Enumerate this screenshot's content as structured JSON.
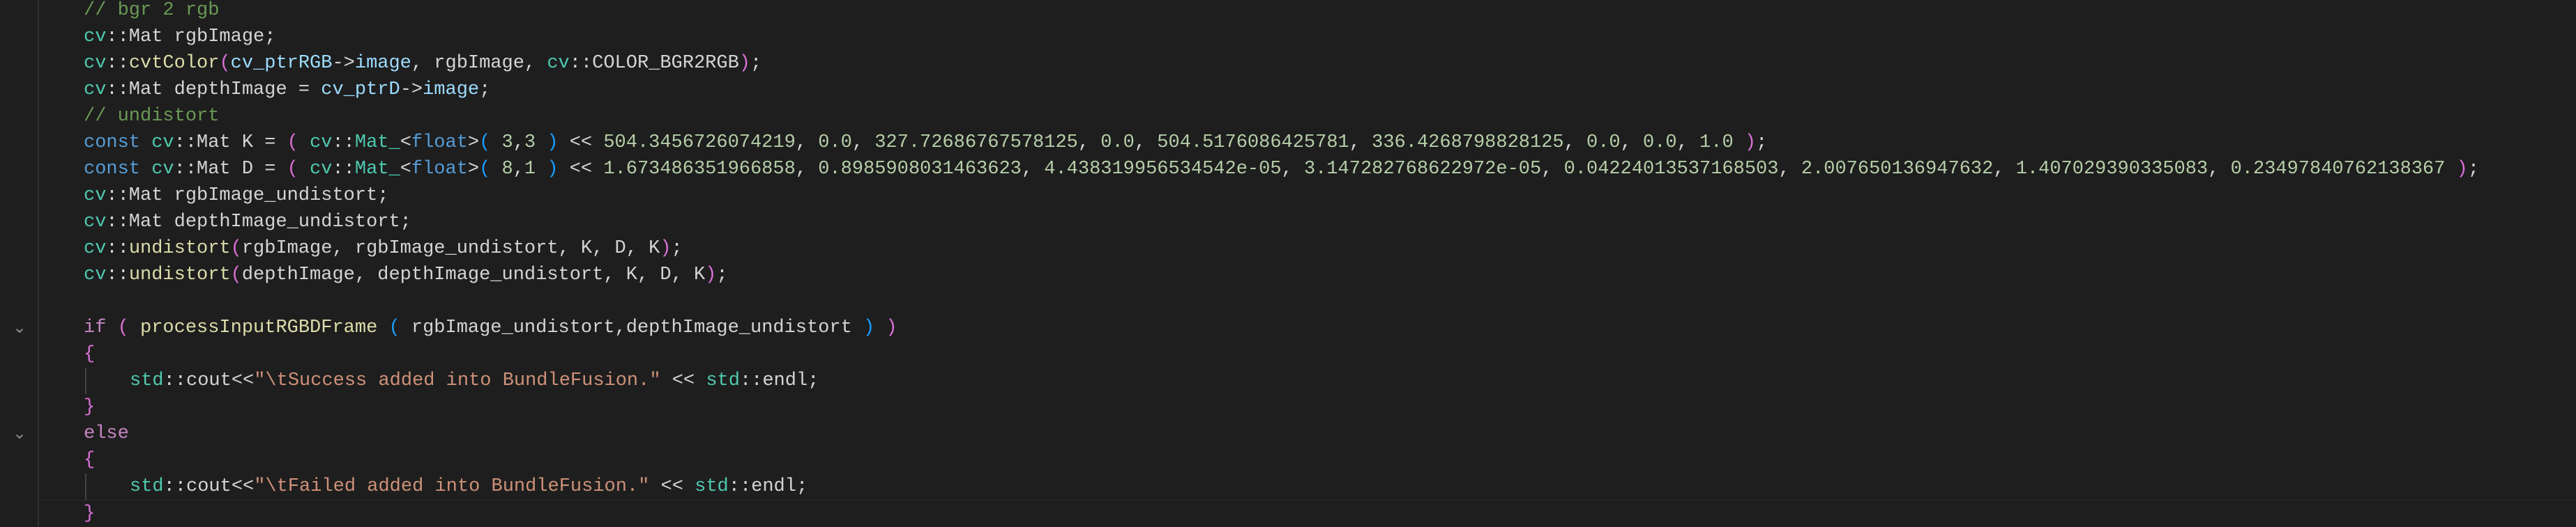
{
  "editor": {
    "language": "cpp",
    "lines": [
      {
        "indent": 0,
        "fold": false,
        "tokens": [
          {
            "t": "// bgr 2 rgb",
            "c": "cm"
          }
        ]
      },
      {
        "indent": 0,
        "fold": false,
        "tokens": [
          {
            "t": "cv",
            "c": "ns"
          },
          {
            "t": "::Mat rgbImage;",
            "c": "pl"
          }
        ]
      },
      {
        "indent": 0,
        "fold": false,
        "tokens": [
          {
            "t": "cv",
            "c": "ns"
          },
          {
            "t": "::",
            "c": "pl"
          },
          {
            "t": "cvtColor",
            "c": "fn"
          },
          {
            "t": "(",
            "c": "b1"
          },
          {
            "t": "cv_ptrRGB",
            "c": "va"
          },
          {
            "t": "->",
            "c": "pl"
          },
          {
            "t": "image",
            "c": "va"
          },
          {
            "t": ", rgbImage, ",
            "c": "pl"
          },
          {
            "t": "cv",
            "c": "ns"
          },
          {
            "t": "::COLOR_BGR2RGB",
            "c": "pl"
          },
          {
            "t": ")",
            "c": "b1"
          },
          {
            "t": ";",
            "c": "pl"
          }
        ]
      },
      {
        "indent": 0,
        "fold": false,
        "tokens": [
          {
            "t": "cv",
            "c": "ns"
          },
          {
            "t": "::Mat depthImage = ",
            "c": "pl"
          },
          {
            "t": "cv_ptrD",
            "c": "va"
          },
          {
            "t": "->",
            "c": "pl"
          },
          {
            "t": "image",
            "c": "va"
          },
          {
            "t": ";",
            "c": "pl"
          }
        ]
      },
      {
        "indent": 0,
        "fold": false,
        "tokens": [
          {
            "t": "// undistort",
            "c": "cm"
          }
        ]
      },
      {
        "indent": 0,
        "fold": false,
        "tokens": [
          {
            "t": "const ",
            "c": "kw"
          },
          {
            "t": "cv",
            "c": "ns"
          },
          {
            "t": "::Mat K = ",
            "c": "pl"
          },
          {
            "t": "( ",
            "c": "b1"
          },
          {
            "t": "cv",
            "c": "ns"
          },
          {
            "t": "::",
            "c": "pl"
          },
          {
            "t": "Mat_",
            "c": "ty"
          },
          {
            "t": "<",
            "c": "pl"
          },
          {
            "t": "float",
            "c": "kw"
          },
          {
            "t": ">",
            "c": "pl"
          },
          {
            "t": "( ",
            "c": "b2"
          },
          {
            "t": "3",
            "c": "nu"
          },
          {
            "t": ",",
            "c": "pl"
          },
          {
            "t": "3",
            "c": "nu"
          },
          {
            "t": " )",
            "c": "b2"
          },
          {
            "t": " << ",
            "c": "pl"
          },
          {
            "t": "504.3456726074219",
            "c": "nu"
          },
          {
            "t": ", ",
            "c": "pl"
          },
          {
            "t": "0.0",
            "c": "nu"
          },
          {
            "t": ", ",
            "c": "pl"
          },
          {
            "t": "327.72686767578125",
            "c": "nu"
          },
          {
            "t": ", ",
            "c": "pl"
          },
          {
            "t": "0.0",
            "c": "nu"
          },
          {
            "t": ", ",
            "c": "pl"
          },
          {
            "t": "504.5176086425781",
            "c": "nu"
          },
          {
            "t": ", ",
            "c": "pl"
          },
          {
            "t": "336.4268798828125",
            "c": "nu"
          },
          {
            "t": ", ",
            "c": "pl"
          },
          {
            "t": "0.0",
            "c": "nu"
          },
          {
            "t": ", ",
            "c": "pl"
          },
          {
            "t": "0.0",
            "c": "nu"
          },
          {
            "t": ", ",
            "c": "pl"
          },
          {
            "t": "1.0",
            "c": "nu"
          },
          {
            "t": " )",
            "c": "b1"
          },
          {
            "t": ";",
            "c": "pl"
          }
        ]
      },
      {
        "indent": 0,
        "fold": false,
        "tokens": [
          {
            "t": "const ",
            "c": "kw"
          },
          {
            "t": "cv",
            "c": "ns"
          },
          {
            "t": "::Mat D = ",
            "c": "pl"
          },
          {
            "t": "( ",
            "c": "b1"
          },
          {
            "t": "cv",
            "c": "ns"
          },
          {
            "t": "::",
            "c": "pl"
          },
          {
            "t": "Mat_",
            "c": "ty"
          },
          {
            "t": "<",
            "c": "pl"
          },
          {
            "t": "float",
            "c": "kw"
          },
          {
            "t": ">",
            "c": "pl"
          },
          {
            "t": "( ",
            "c": "b2"
          },
          {
            "t": "8",
            "c": "nu"
          },
          {
            "t": ",",
            "c": "pl"
          },
          {
            "t": "1",
            "c": "nu"
          },
          {
            "t": " )",
            "c": "b2"
          },
          {
            "t": " << ",
            "c": "pl"
          },
          {
            "t": "1.673486351966858",
            "c": "nu"
          },
          {
            "t": ", ",
            "c": "pl"
          },
          {
            "t": "0.8985908031463623",
            "c": "nu"
          },
          {
            "t": ", ",
            "c": "pl"
          },
          {
            "t": "4.438319956534542e-05",
            "c": "nu"
          },
          {
            "t": ", ",
            "c": "pl"
          },
          {
            "t": "3.147282768622972e-05",
            "c": "nu"
          },
          {
            "t": ", ",
            "c": "pl"
          },
          {
            "t": "0.04224013537168503",
            "c": "nu"
          },
          {
            "t": ", ",
            "c": "pl"
          },
          {
            "t": "2.007650136947632",
            "c": "nu"
          },
          {
            "t": ", ",
            "c": "pl"
          },
          {
            "t": "1.407029390335083",
            "c": "nu"
          },
          {
            "t": ", ",
            "c": "pl"
          },
          {
            "t": "0.23497840762138367",
            "c": "nu"
          },
          {
            "t": " )",
            "c": "b1"
          },
          {
            "t": ";",
            "c": "pl"
          }
        ]
      },
      {
        "indent": 0,
        "fold": false,
        "tokens": [
          {
            "t": "cv",
            "c": "ns"
          },
          {
            "t": "::Mat rgbImage_undistort;",
            "c": "pl"
          }
        ]
      },
      {
        "indent": 0,
        "fold": false,
        "tokens": [
          {
            "t": "cv",
            "c": "ns"
          },
          {
            "t": "::Mat depthImage_undistort;",
            "c": "pl"
          }
        ]
      },
      {
        "indent": 0,
        "fold": false,
        "tokens": [
          {
            "t": "cv",
            "c": "ns"
          },
          {
            "t": "::",
            "c": "pl"
          },
          {
            "t": "undistort",
            "c": "fn"
          },
          {
            "t": "(",
            "c": "b1"
          },
          {
            "t": "rgbImage, rgbImage_undistort, K, D, K",
            "c": "pl"
          },
          {
            "t": ")",
            "c": "b1"
          },
          {
            "t": ";",
            "c": "pl"
          }
        ]
      },
      {
        "indent": 0,
        "fold": false,
        "tokens": [
          {
            "t": "cv",
            "c": "ns"
          },
          {
            "t": "::",
            "c": "pl"
          },
          {
            "t": "undistort",
            "c": "fn"
          },
          {
            "t": "(",
            "c": "b1"
          },
          {
            "t": "depthImage, depthImage_undistort, K, D, K",
            "c": "pl"
          },
          {
            "t": ")",
            "c": "b1"
          },
          {
            "t": ";",
            "c": "pl"
          }
        ]
      },
      {
        "indent": 0,
        "fold": false,
        "tokens": []
      },
      {
        "indent": 0,
        "fold": true,
        "tokens": [
          {
            "t": "if ",
            "c": "kc"
          },
          {
            "t": "( ",
            "c": "b1"
          },
          {
            "t": "processInputRGBDFrame",
            "c": "fn"
          },
          {
            "t": " ",
            "c": "pl"
          },
          {
            "t": "( ",
            "c": "b2"
          },
          {
            "t": "rgbImage_undistort,depthImage_undistort",
            "c": "pl"
          },
          {
            "t": " )",
            "c": "b2"
          },
          {
            "t": " )",
            "c": "b1"
          }
        ]
      },
      {
        "indent": 0,
        "fold": false,
        "tokens": [
          {
            "t": "{",
            "c": "b1"
          }
        ]
      },
      {
        "indent": 1,
        "fold": false,
        "tokens": [
          {
            "t": "std",
            "c": "ns"
          },
          {
            "t": "::cout<<",
            "c": "pl"
          },
          {
            "t": "\"\\tSuccess added into BundleFusion.\"",
            "c": "st"
          },
          {
            "t": " << ",
            "c": "pl"
          },
          {
            "t": "std",
            "c": "ns"
          },
          {
            "t": "::endl;",
            "c": "pl"
          }
        ]
      },
      {
        "indent": 0,
        "fold": false,
        "tokens": [
          {
            "t": "}",
            "c": "b1"
          }
        ]
      },
      {
        "indent": 0,
        "fold": true,
        "tokens": [
          {
            "t": "else",
            "c": "kc"
          }
        ]
      },
      {
        "indent": 0,
        "fold": false,
        "tokens": [
          {
            "t": "{",
            "c": "b1"
          }
        ]
      },
      {
        "indent": 1,
        "fold": false,
        "tokens": [
          {
            "t": "std",
            "c": "ns"
          },
          {
            "t": "::cout<<",
            "c": "pl"
          },
          {
            "t": "\"\\tFailed added into BundleFusion.\"",
            "c": "st"
          },
          {
            "t": " << ",
            "c": "pl"
          },
          {
            "t": "std",
            "c": "ns"
          },
          {
            "t": "::endl;",
            "c": "pl"
          }
        ]
      },
      {
        "indent": 0,
        "fold": false,
        "tokens": [
          {
            "t": "}",
            "c": "b1"
          }
        ]
      }
    ]
  },
  "icons": {
    "fold": "chevron-down-icon",
    "fold_glyph": "⌄"
  },
  "colors": {
    "background": "#1e1e1e",
    "comment": "#6a9955",
    "namespace_type": "#4ec9b0",
    "function": "#dcdcaa",
    "variable": "#9cdcfe",
    "keyword": "#569cd6",
    "control_keyword": "#c586c0",
    "number": "#b5cea8",
    "string": "#ce9178",
    "bracket_level1": "#da70d6",
    "bracket_level2": "#179fff"
  }
}
